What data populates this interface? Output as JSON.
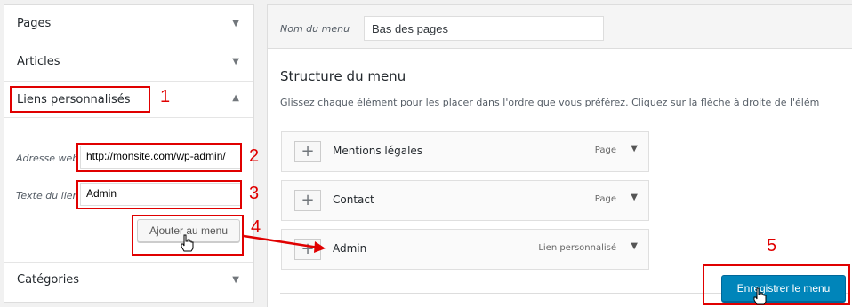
{
  "sidebar": {
    "sections": [
      {
        "label": "Pages"
      },
      {
        "label": "Articles"
      },
      {
        "label": "Liens personnalisés"
      },
      {
        "label": "Catégories"
      }
    ],
    "custom_link": {
      "url_label": "Adresse web",
      "url_value": "http://monsite.com/wp-admin/",
      "text_label": "Texte du lien",
      "text_value": "Admin",
      "add_button": "Ajouter au menu"
    }
  },
  "menu": {
    "name_label": "Nom du menu",
    "name_value": "Bas des pages",
    "structure_title": "Structure du menu",
    "structure_desc": "Glissez chaque élément pour les placer dans l'ordre que vous préférez. Cliquez sur la flèche à droite de l'élém",
    "items": [
      {
        "title": "Mentions légales",
        "type": "Page"
      },
      {
        "title": "Contact",
        "type": "Page"
      },
      {
        "title": "Admin",
        "type": "Lien personnalisé"
      }
    ],
    "save_button": "Enregistrer le menu"
  },
  "annotations": {
    "steps": [
      "1",
      "2",
      "3",
      "4",
      "5"
    ],
    "color": "#e00000"
  },
  "icons": {
    "collapse": "chevron-down-icon",
    "expand": "chevron-up-icon",
    "add": "plus-icon",
    "cursor": "hand-pointer-icon"
  },
  "colors": {
    "primary_button": "#0085ba",
    "annotation": "#e00000"
  }
}
